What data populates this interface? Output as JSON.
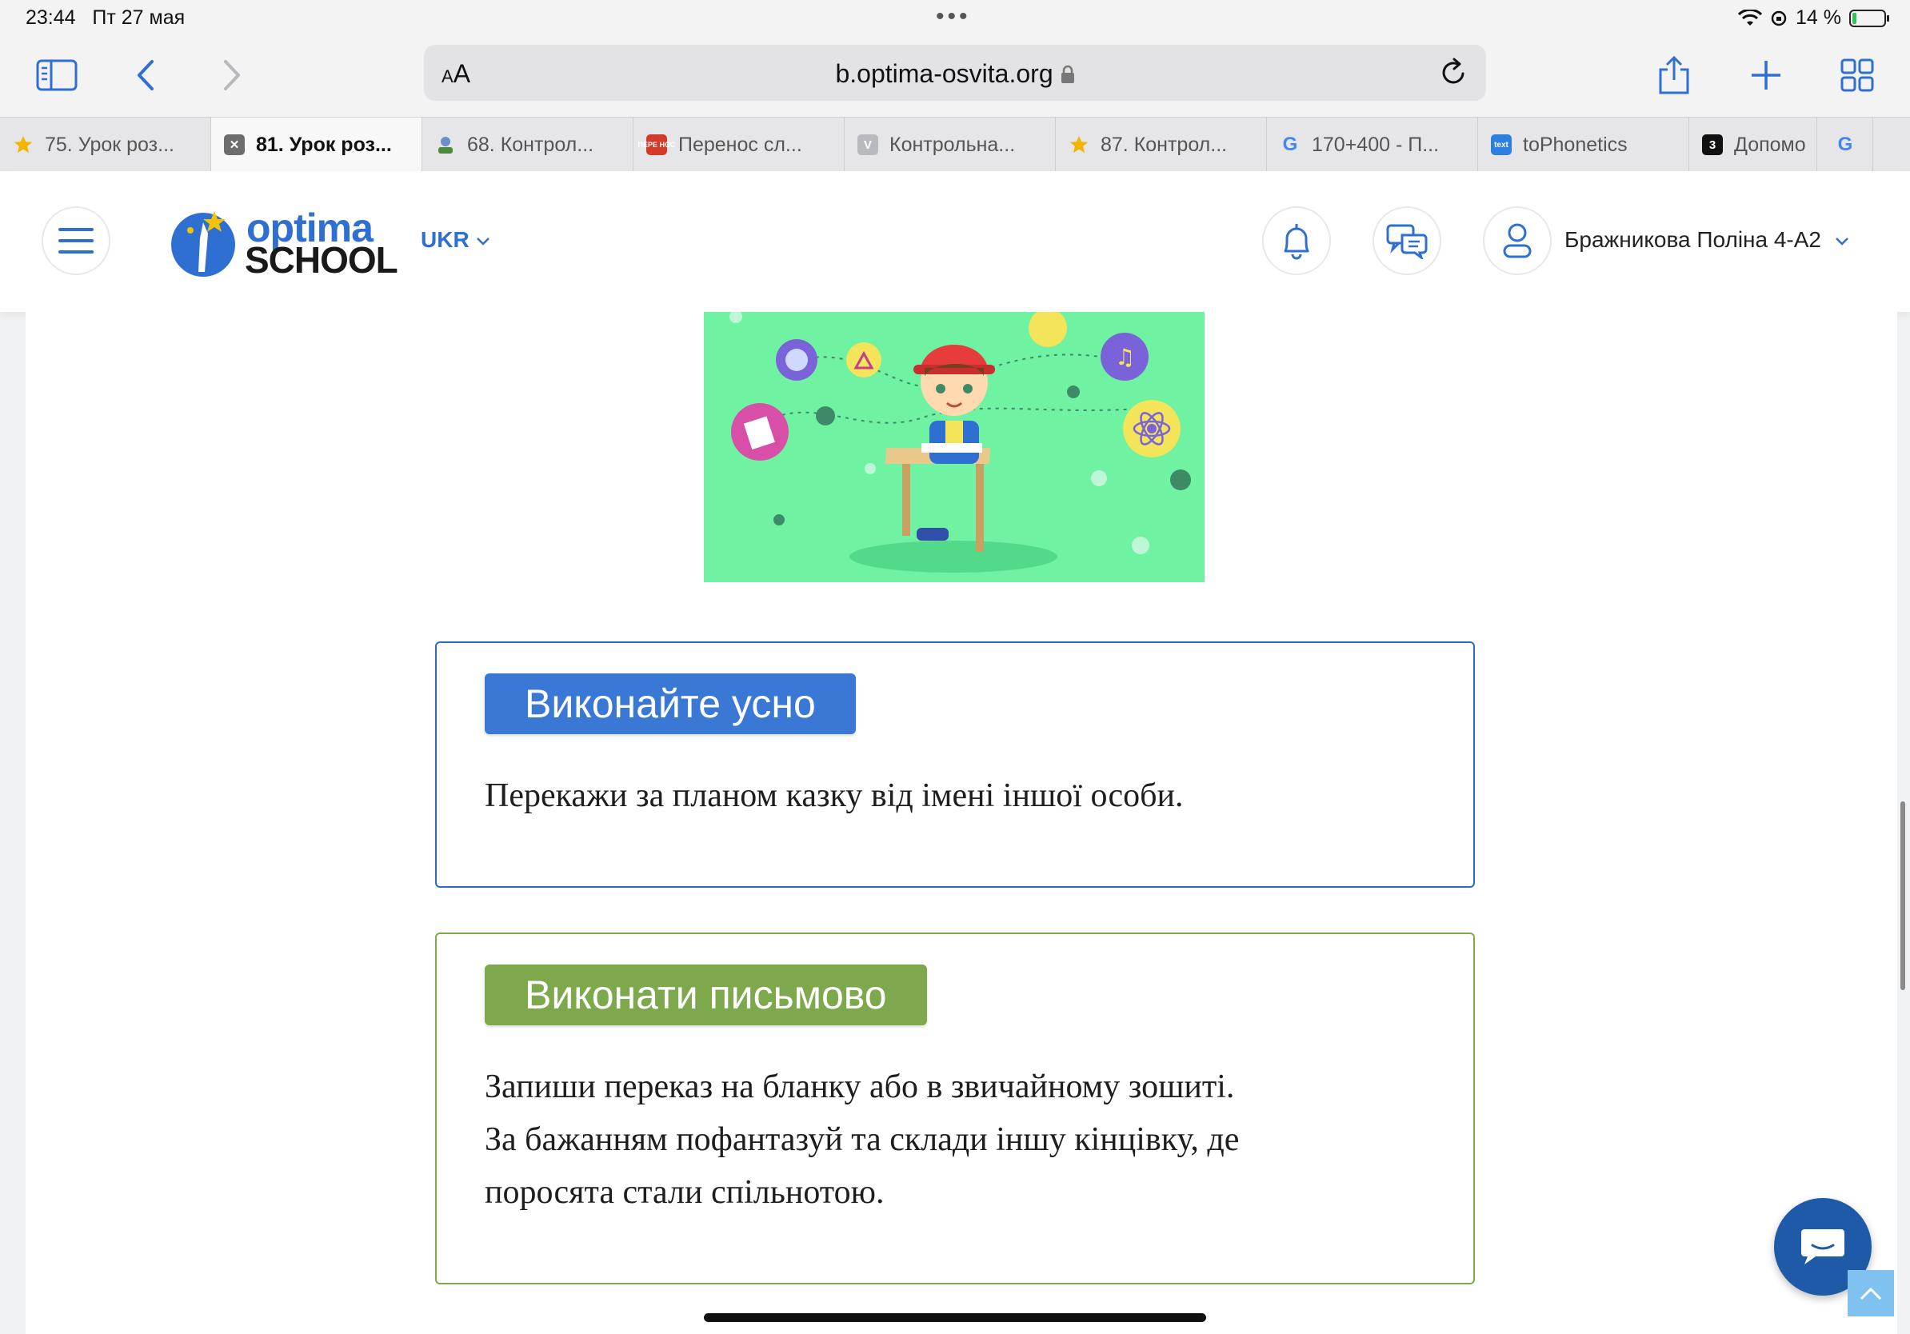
{
  "status_bar": {
    "time": "23:44",
    "date": "Пт 27 мая",
    "battery": "14 %",
    "battery_level": 0.14
  },
  "browser": {
    "url": "b.optima-osvita.org",
    "text_size_label": "AA"
  },
  "tabs": [
    {
      "label": "75. Урок роз...",
      "favicon": "star-icon",
      "color": "#f5b400"
    },
    {
      "label": "81. Урок роз...",
      "favicon": "close-icon",
      "color": "#6d6d6d",
      "active": true
    },
    {
      "label": "68. Контрол...",
      "favicon": "avatar-icon",
      "color": "#4a8a3f"
    },
    {
      "label": "Перенос сл...",
      "favicon": "text-icon",
      "color": "#d23a2a",
      "badge": "ПЕРЕ НОС"
    },
    {
      "label": "Контрольна...",
      "favicon": "letter-icon",
      "color": "#b9b9c0",
      "badge": "V"
    },
    {
      "label": "87. Контрол...",
      "favicon": "star-icon",
      "color": "#f5b400"
    },
    {
      "label": "170+400 - П...",
      "favicon": "google-icon",
      "color": "#ffffff",
      "badge": "G"
    },
    {
      "label": "toPhonetics",
      "favicon": "text-icon",
      "color": "#2d7fe0",
      "badge": "text"
    },
    {
      "label": "Допомо",
      "favicon": "number-icon",
      "color": "#111111",
      "badge": "3"
    },
    {
      "label": "",
      "favicon": "google-icon",
      "color": "#ffffff",
      "badge": "G"
    }
  ],
  "site": {
    "logo_top": "optima",
    "logo_bottom": "SCHOOL",
    "language": "UKR",
    "user_name": "Бражникова Поліна 4-А2"
  },
  "tasks": [
    {
      "badge": "Виконайте усно",
      "color": "#3a78d6",
      "lines": [
        "Перекажи за планом казку від імені іншої особи."
      ]
    },
    {
      "badge": "Виконати письмово",
      "color": "#7da84c",
      "lines": [
        "Запиши переказ на бланку або в звичайному зошиті.",
        "За бажанням пофантазуй та склади іншу кінцівку, де",
        "поросята стали спільнотою."
      ]
    }
  ]
}
